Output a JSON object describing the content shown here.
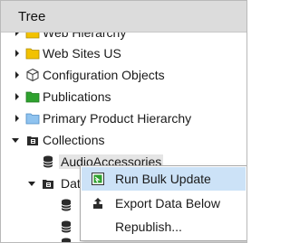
{
  "panel": {
    "title": "Tree"
  },
  "tree": {
    "items": [
      {
        "label": "Web Hierarchy",
        "icon": "folder-icon",
        "expanded": false
      },
      {
        "label": "Web Sites US",
        "icon": "folder-icon",
        "expanded": false
      },
      {
        "label": "Configuration Objects",
        "icon": "cube-icon",
        "expanded": false
      },
      {
        "label": "Publications",
        "icon": "green-folder-icon",
        "expanded": false
      },
      {
        "label": "Primary Product Hierarchy",
        "icon": "blue-folder-icon",
        "expanded": false
      },
      {
        "label": "Collections",
        "icon": "collection-icon",
        "expanded": true
      },
      {
        "label": "AudioAccessories",
        "icon": "database-icon"
      },
      {
        "label": "Dat",
        "icon": "collection-icon",
        "expanded": true
      },
      {
        "label": "",
        "icon": "database-icon"
      },
      {
        "label": "",
        "icon": "database-icon"
      },
      {
        "label": "",
        "icon": "database-icon"
      }
    ]
  },
  "context_menu": {
    "items": [
      {
        "label": "Run Bulk Update",
        "icon": "run-bulk-update-icon",
        "active": true
      },
      {
        "label": "Export Data Below",
        "icon": "export-icon",
        "active": false
      },
      {
        "label": "Republish...",
        "icon": "",
        "active": false
      }
    ]
  },
  "colors": {
    "header_bg": "#dcdcdc",
    "menu_highlight": "#cce2f7",
    "folder_yellow": "#f2c200",
    "folder_green": "#2fa12f",
    "folder_blue": "#8fc3ef"
  }
}
